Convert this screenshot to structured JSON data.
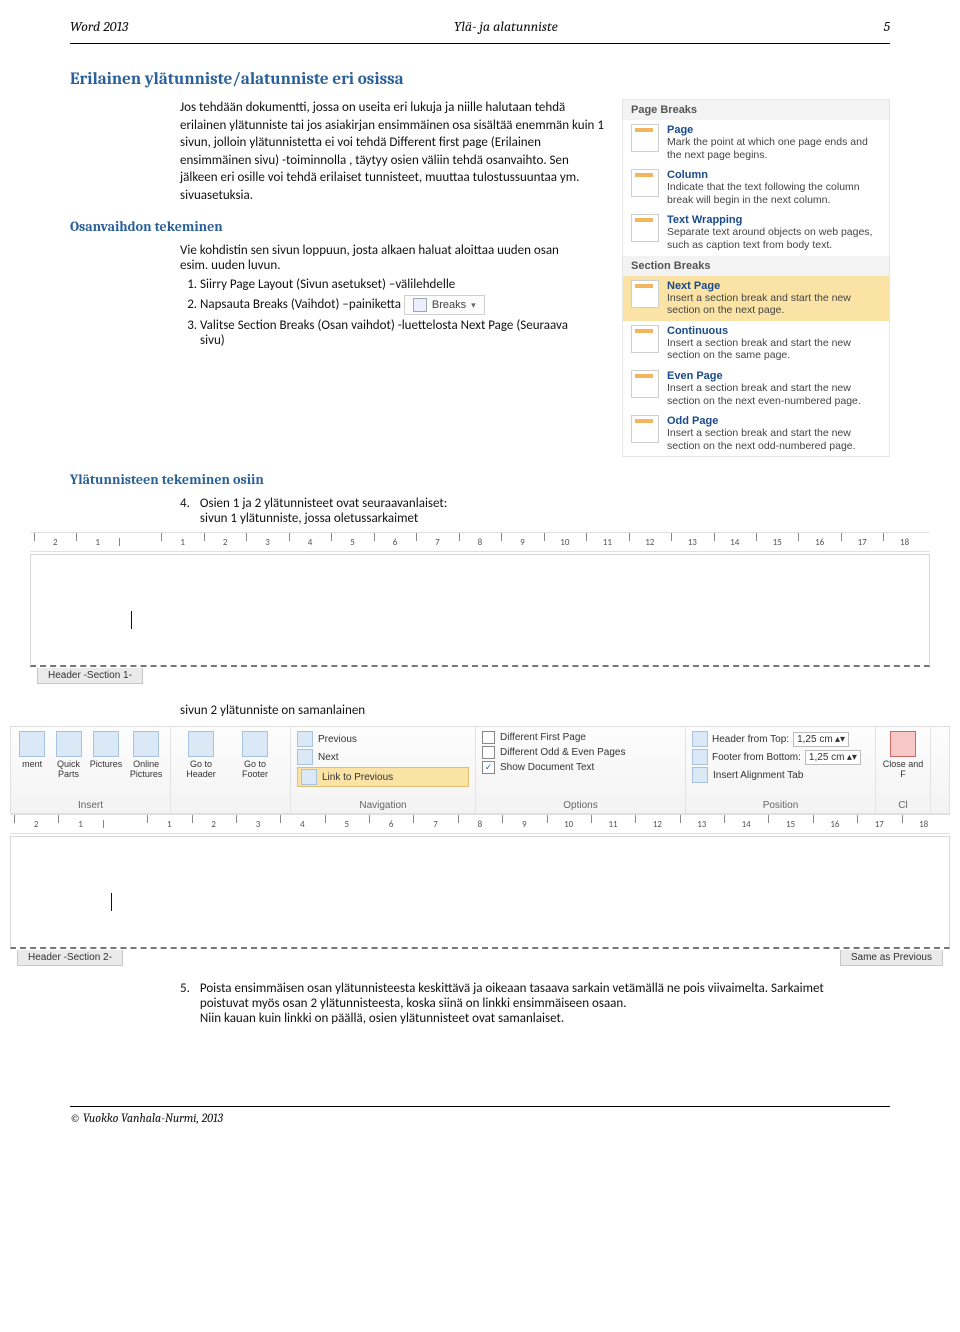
{
  "header": {
    "left": "Word 2013",
    "center": "Ylä- ja alatunniste",
    "right": "5"
  },
  "h1": "Erilainen ylätunniste/alatunniste eri osissa",
  "intro_para": "Jos tehdään dokumentti, jossa on useita eri lukuja ja niille halutaan tehdä erilainen ylätunniste tai jos asiakirjan ensimmäinen osa sisältää enemmän kuin 1 sivun, jolloin ylätunnistetta ei voi tehdä Different first page (Erilainen ensimmäinen sivu) -toiminnolla , täytyy osien väliin tehdä osanvaihto. Sen jälkeen eri osille voi tehdä erilaiset tunnisteet, muuttaa tulostussuuntaa ym. sivuasetuksia.",
  "breaks_panel": {
    "group1": "Page Breaks",
    "items1": [
      {
        "t": "Page",
        "d": "Mark the point at which one page ends and the next page begins."
      },
      {
        "t": "Column",
        "d": "Indicate that the text following the column break will begin in the next column."
      },
      {
        "t": "Text Wrapping",
        "d": "Separate text around objects on web pages, such as caption text from body text."
      }
    ],
    "group2": "Section Breaks",
    "items2": [
      {
        "t": "Next Page",
        "d": "Insert a section break and start the new section on the next page."
      },
      {
        "t": "Continuous",
        "d": "Insert a section break and start the new section on the same page."
      },
      {
        "t": "Even Page",
        "d": "Insert a section break and start the new section on the next even-numbered page."
      },
      {
        "t": "Odd Page",
        "d": "Insert a section break and start the new section on the next odd-numbered page."
      }
    ]
  },
  "sub1": "Osanvaihdon tekeminen",
  "sub1_lead": "Vie kohdistin sen sivun loppuun, josta alkaen haluat aloittaa uuden osan esim. uuden luvun.",
  "sub1_steps": [
    "Siirry Page Layout (Sivun asetukset) –välilehdelle",
    "Napsauta Breaks (Vaihdot) –painiketta",
    "Valitse Section Breaks (Osan vaihdot) -luettelosta Next Page (Seuraava sivu)"
  ],
  "breaks_btn": "Breaks",
  "sub2": "Ylätunnisteen tekeminen osiin",
  "sub2_lead_num": "4.",
  "sub2_lead": "Osien 1 ja 2 ylätunnisteet ovat seuraavanlaiset:\nsivun 1 ylätunniste, jossa oletussarkaimet",
  "ruler_ticks": [
    "2",
    "1",
    "",
    "1",
    "2",
    "3",
    "4",
    "5",
    "6",
    "7",
    "8",
    "9",
    "10",
    "11",
    "12",
    "13",
    "14",
    "15",
    "16",
    "17",
    "18"
  ],
  "hdr_label1": "Header -Section 1-",
  "caption_mid": "sivun 2 ylätunniste on samanlainen",
  "ribbon": {
    "insert_items": [
      "ment",
      "Quick Parts",
      "Pictures",
      "Online Pictures"
    ],
    "insert_title": "Insert",
    "nav": {
      "goto_h": "Go to Header",
      "goto_f": "Go to Footer",
      "prev": "Previous",
      "next": "Next",
      "link": "Link to Previous",
      "title": "Navigation"
    },
    "options": {
      "dfp": "Different First Page",
      "doe": "Different Odd & Even Pages",
      "sdt": "Show Document Text",
      "title": "Options"
    },
    "position": {
      "hft": "Header from Top:",
      "ffb": "Footer from Bottom:",
      "iat": "Insert Alignment Tab",
      "val": "1,25 cm",
      "title": "Position"
    },
    "close": {
      "label": "Close and F",
      "title": "Cl"
    }
  },
  "hdr_label2": "Header -Section 2-",
  "hdr_label2r": "Same as Previous",
  "final_num": "5.",
  "final_text": "Poista ensimmäisen osan ylätunnisteesta keskittävä ja oikeaan tasaava sarkain vetämällä ne pois viivaimelta. Sarkaimet poistuvat myös osan 2 ylätunnisteesta, koska siinä on linkki ensimmäiseen osaan.\nNiin kauan kuin linkki on päällä, osien ylätunnisteet ovat samanlaiset.",
  "footer": "© Vuokko Vanhala-Nurmi, 2013"
}
